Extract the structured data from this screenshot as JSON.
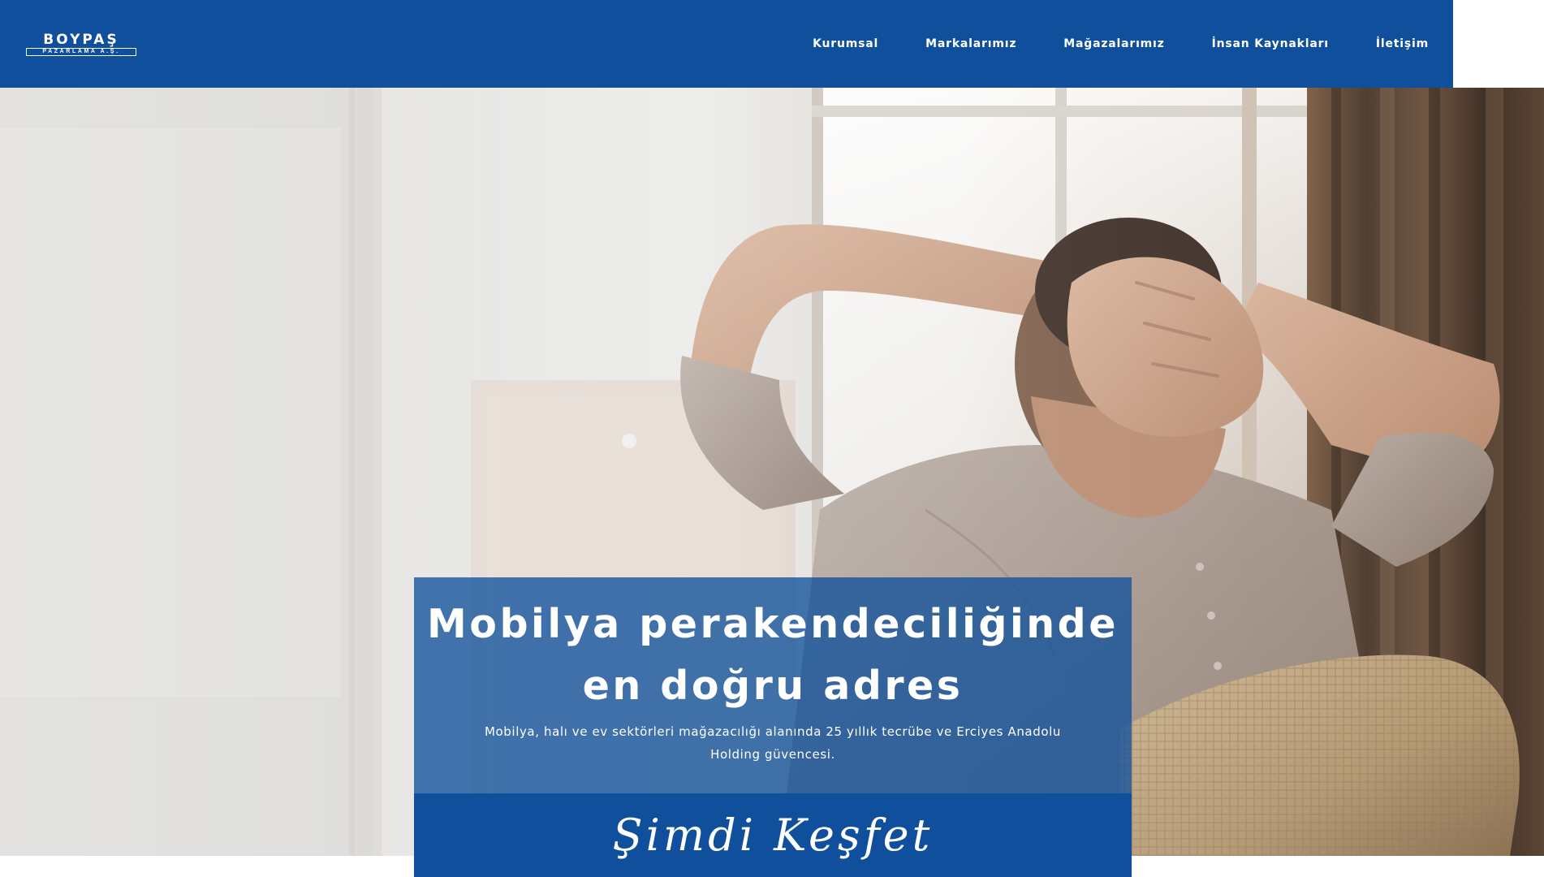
{
  "header": {
    "logo": {
      "name": "BOYPAŞ",
      "tagline": "PAZARLAMA A.Ş."
    },
    "nav": [
      {
        "label": "Kurumsal"
      },
      {
        "label": "Markalarımız"
      },
      {
        "label": "Mağazalarımız"
      },
      {
        "label": "İnsan Kaynakları"
      },
      {
        "label": "İletişim"
      }
    ]
  },
  "hero": {
    "headline_line1": "Mobilya perakendeciliğinde",
    "headline_line2": "en doğru adres",
    "subtext": "Mobilya, halı ve ev sektörleri mağazacılığı alanında 25 yıllık tecrübe ve Erciyes Anadolu Holding güvencesi.",
    "cta": "Şimdi Keşfet"
  },
  "colors": {
    "brand_blue": "#0f4f9b",
    "caption_overlay": "#11519b",
    "text_light": "#ffffff"
  }
}
